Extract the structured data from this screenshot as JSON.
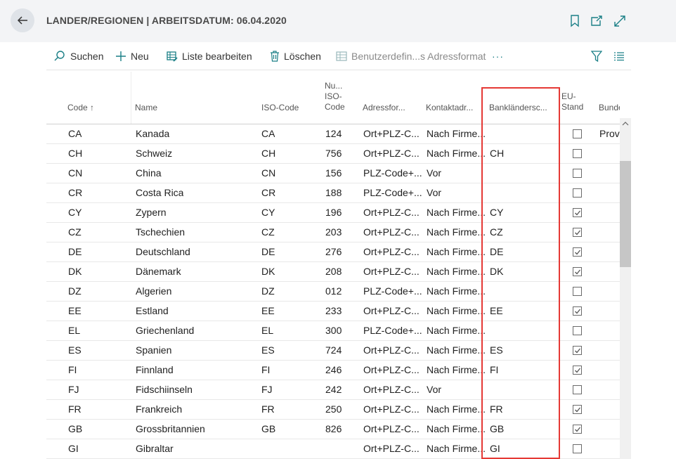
{
  "header": {
    "title": "LANDER/REGIONEN | ARBEITSDATUM: 06.04.2020",
    "icons": [
      "back-arrow-icon",
      "bookmark-icon",
      "open-new-window-icon",
      "expand-icon"
    ]
  },
  "toolbar": {
    "search_label": "Suchen",
    "new_label": "Neu",
    "edit_list_label": "Liste bearbeiten",
    "delete_label": "Löschen",
    "custom_address_label": "Benutzerdefin...s Adressformat",
    "more_label": "···",
    "icons": [
      "search-icon",
      "plus-icon",
      "edit-list-icon",
      "trash-icon",
      "address-format-icon",
      "filter-icon",
      "list-view-icon"
    ]
  },
  "columns": {
    "code": "Code",
    "code_sort": "↑",
    "name": "Name",
    "iso_code": "ISO-Code",
    "numeric_iso_1": "Nu...",
    "numeric_iso_2": "ISO-",
    "numeric_iso_3": "Code",
    "address_format": "Adressfor...",
    "contact_address": "Kontaktadr...",
    "bank_country_code": "Bankländersc...",
    "eu_1": "EU-",
    "eu_2": "Standard",
    "federal": "Bundesregion"
  },
  "rows": [
    {
      "code": "CA",
      "name": "Kanada",
      "iso": "CA",
      "num": "124",
      "addr": "Ort+PLZ-C...",
      "contact": "Nach Firme...",
      "bank": null,
      "eu": false,
      "federal": "Provinz"
    },
    {
      "code": "CH",
      "name": "Schweiz",
      "iso": "CH",
      "num": "756",
      "addr": "Ort+PLZ-C...",
      "contact": "Nach Firme...",
      "bank": "CH",
      "eu": false,
      "federal": null
    },
    {
      "code": "CN",
      "name": "China",
      "iso": "CN",
      "num": "156",
      "addr": "PLZ-Code+...",
      "contact": "Vor",
      "bank": null,
      "eu": false,
      "federal": null
    },
    {
      "code": "CR",
      "name": "Costa Rica",
      "iso": "CR",
      "num": "188",
      "addr": "PLZ-Code+...",
      "contact": "Vor",
      "bank": null,
      "eu": false,
      "federal": null
    },
    {
      "code": "CY",
      "name": "Zypern",
      "iso": "CY",
      "num": "196",
      "addr": "Ort+PLZ-C...",
      "contact": "Nach Firme...",
      "bank": "CY",
      "eu": true,
      "federal": null
    },
    {
      "code": "CZ",
      "name": "Tschechien",
      "iso": "CZ",
      "num": "203",
      "addr": "Ort+PLZ-C...",
      "contact": "Nach Firme...",
      "bank": "CZ",
      "eu": true,
      "federal": null
    },
    {
      "code": "DE",
      "name": "Deutschland",
      "iso": "DE",
      "num": "276",
      "addr": "Ort+PLZ-C...",
      "contact": "Nach Firme...",
      "bank": "DE",
      "eu": true,
      "federal": null
    },
    {
      "code": "DK",
      "name": "Dänemark",
      "iso": "DK",
      "num": "208",
      "addr": "Ort+PLZ-C...",
      "contact": "Nach Firme...",
      "bank": "DK",
      "eu": true,
      "federal": null
    },
    {
      "code": "DZ",
      "name": "Algerien",
      "iso": "DZ",
      "num": "012",
      "addr": "PLZ-Code+...",
      "contact": "Nach Firme...",
      "bank": null,
      "eu": false,
      "federal": null
    },
    {
      "code": "EE",
      "name": "Estland",
      "iso": "EE",
      "num": "233",
      "addr": "Ort+PLZ-C...",
      "contact": "Nach Firme...",
      "bank": "EE",
      "eu": true,
      "federal": null
    },
    {
      "code": "EL",
      "name": "Griechenland",
      "iso": "EL",
      "num": "300",
      "addr": "PLZ-Code+...",
      "contact": "Nach Firme...",
      "bank": null,
      "eu": false,
      "federal": null
    },
    {
      "code": "ES",
      "name": "Spanien",
      "iso": "ES",
      "num": "724",
      "addr": "Ort+PLZ-C...",
      "contact": "Nach Firme...",
      "bank": "ES",
      "eu": true,
      "federal": null
    },
    {
      "code": "FI",
      "name": "Finnland",
      "iso": "FI",
      "num": "246",
      "addr": "Ort+PLZ-C...",
      "contact": "Nach Firme...",
      "bank": "FI",
      "eu": true,
      "federal": null
    },
    {
      "code": "FJ",
      "name": "Fidschiinseln",
      "iso": "FJ",
      "num": "242",
      "addr": "Ort+PLZ-C...",
      "contact": "Vor",
      "bank": null,
      "eu": false,
      "federal": null
    },
    {
      "code": "FR",
      "name": "Frankreich",
      "iso": "FR",
      "num": "250",
      "addr": "Ort+PLZ-C...",
      "contact": "Nach Firme...",
      "bank": "FR",
      "eu": true,
      "federal": null
    },
    {
      "code": "GB",
      "name": "Grossbritannien",
      "iso": "GB",
      "num": "826",
      "addr": "Ort+PLZ-C...",
      "contact": "Nach Firme...",
      "bank": "GB",
      "eu": true,
      "federal": null
    },
    {
      "code": "GI",
      "name": "Gibraltar",
      "iso": null,
      "num": null,
      "addr": "Ort+PLZ-C...",
      "contact": "Nach Firme...",
      "bank": "GI",
      "eu": false,
      "federal": null
    }
  ],
  "colors": {
    "highlight": "#e53935",
    "accent": "#1a7f86",
    "header_bg": "#f3f4f6"
  }
}
